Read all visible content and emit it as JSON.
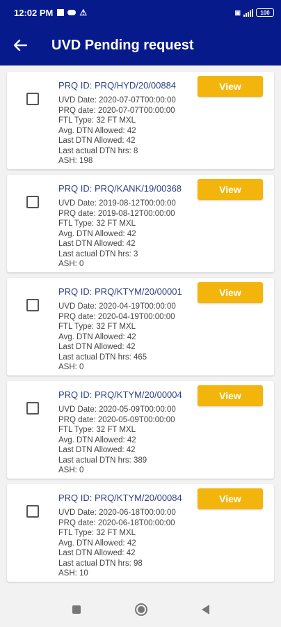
{
  "status_bar": {
    "time": "12:02 PM",
    "battery": "100"
  },
  "app_bar": {
    "title": "UVD Pending request"
  },
  "colors": {
    "primary": "#061a8c",
    "accent": "#f3b50b",
    "prq_id_text": "#2f3f86"
  },
  "requests": [
    {
      "prq_id": "PRQ ID: PRQ/HYD/20/00884",
      "lines": [
        "UVD Date: 2020-07-07T00:00:00",
        "PRQ date: 2020-07-07T00:00:00",
        "FTL Type: 32 FT MXL",
        "Avg. DTN Allowed: 42",
        "Last DTN Allowed: 42",
        "Last actual DTN hrs: 8",
        "ASH: 198"
      ],
      "button": "View"
    },
    {
      "prq_id": "PRQ ID: PRQ/KANK/19/00368",
      "lines": [
        "UVD Date: 2019-08-12T00:00:00",
        "PRQ date: 2019-08-12T00:00:00",
        "FTL Type: 32 FT MXL",
        "Avg. DTN Allowed: 42",
        "Last DTN Allowed: 42",
        "Last actual DTN hrs: 3",
        "ASH: 0"
      ],
      "button": "View"
    },
    {
      "prq_id": "PRQ ID: PRQ/KTYM/20/00001",
      "lines": [
        "UVD Date: 2020-04-19T00:00:00",
        "PRQ date: 2020-04-19T00:00:00",
        "FTL Type: 32 FT MXL",
        "Avg. DTN Allowed: 42",
        "Last DTN Allowed: 42",
        "Last actual DTN hrs: 465",
        "ASH: 0"
      ],
      "button": "View"
    },
    {
      "prq_id": "PRQ ID: PRQ/KTYM/20/00004",
      "lines": [
        "UVD Date: 2020-05-09T00:00:00",
        "PRQ date: 2020-05-09T00:00:00",
        "FTL Type: 32 FT MXL",
        "Avg. DTN Allowed: 42",
        "Last DTN Allowed: 42",
        "Last actual DTN hrs: 389",
        "ASH: 0"
      ],
      "button": "View"
    },
    {
      "prq_id": "PRQ ID: PRQ/KTYM/20/00084",
      "lines": [
        "UVD Date: 2020-06-18T00:00:00",
        "PRQ date: 2020-06-18T00:00:00",
        "FTL Type: 32 FT MXL",
        "Avg. DTN Allowed: 42",
        "Last DTN Allowed: 42",
        "Last actual DTN hrs: 98",
        "ASH: 10"
      ],
      "button": "View"
    }
  ],
  "icons": {
    "back": "arrow-left-icon",
    "nav": [
      "recents-square-icon",
      "home-circle-icon",
      "back-triangle-icon"
    ]
  }
}
